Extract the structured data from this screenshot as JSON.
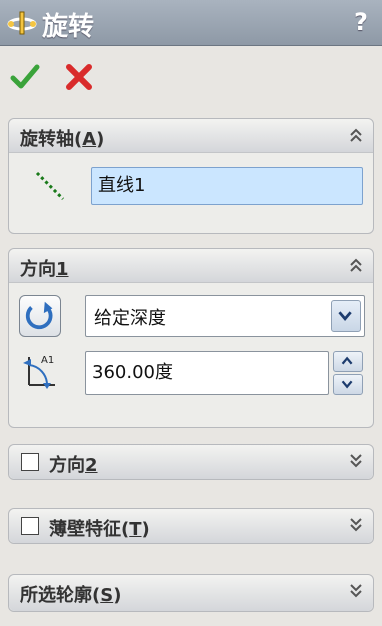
{
  "title_bar": {
    "title": "旋转",
    "help_label": "?",
    "title_icon": "revolve-feature-icon"
  },
  "actions": {
    "ok_icon": "checkmark-icon",
    "cancel_icon": "cancel-x-icon",
    "ok_color": "#3aa33a",
    "cancel_color": "#d92b2b"
  },
  "axis_group": {
    "label_main": "旋转轴",
    "label_paren_open": "(",
    "label_mnemonic": "A",
    "label_paren_close": ")",
    "icon": "axis-line-icon",
    "selected_value": "直线1",
    "expanded": true
  },
  "direction1_group": {
    "label_main": "方向",
    "label_mnemonic": "1",
    "reverse_icon": "reverse-direction-icon",
    "end_condition": "给定深度",
    "angle_icon": "angle-icon",
    "angle_icon_caption": "A1",
    "angle_value": "360.00度",
    "expanded": true
  },
  "direction2_group": {
    "checked": false,
    "label_main": "方向",
    "label_mnemonic": "2",
    "expanded": false
  },
  "thin_feature_group": {
    "checked": false,
    "label_main": "薄壁特征",
    "label_paren_open": "(",
    "label_mnemonic": "T",
    "label_paren_close": ")",
    "expanded": false
  },
  "contours_group": {
    "label_main": "所选轮廓",
    "label_paren_open": "(",
    "label_mnemonic": "S",
    "label_paren_close": ")",
    "expanded": false
  },
  "colors": {
    "title_bar": "#9aa5b1",
    "selection_field": "#cbe6ff",
    "panel_background": "#e8e6e2"
  }
}
